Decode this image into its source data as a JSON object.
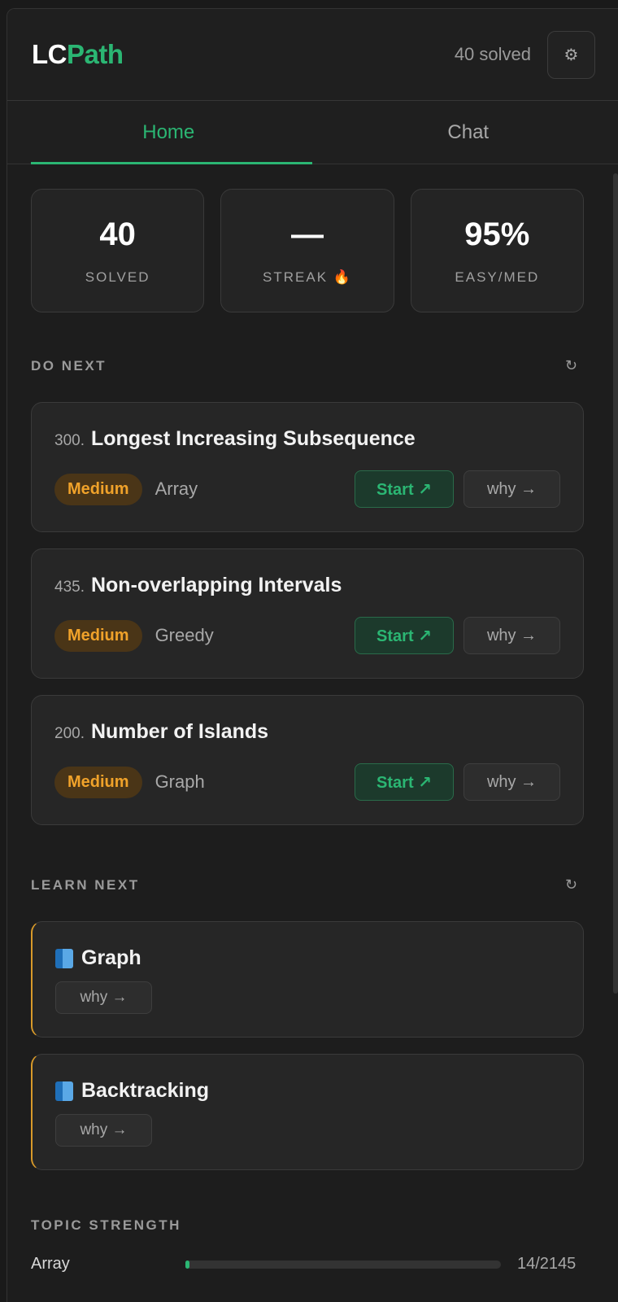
{
  "header": {
    "logo_lc": "LC",
    "logo_path": "Path",
    "solved_text": "40 solved",
    "settings_icon": "gear-icon"
  },
  "tabs": [
    {
      "label": "Home",
      "active": true
    },
    {
      "label": "Chat",
      "active": false
    }
  ],
  "stats": [
    {
      "value": "40",
      "label": "SOLVED"
    },
    {
      "value": "—",
      "label": "STREAK 🔥"
    },
    {
      "value": "95%",
      "label": "EASY/MED"
    }
  ],
  "do_next": {
    "title": "DO NEXT",
    "refresh_icon": "refresh-icon",
    "items": [
      {
        "num": "300.",
        "name": "Longest Increasing Subsequence",
        "difficulty": "Medium",
        "topic": "Array",
        "start": "Start ↗",
        "why": "why →"
      },
      {
        "num": "435.",
        "name": "Non-overlapping Intervals",
        "difficulty": "Medium",
        "topic": "Greedy",
        "start": "Start ↗",
        "why": "why →"
      },
      {
        "num": "200.",
        "name": "Number of Islands",
        "difficulty": "Medium",
        "topic": "Graph",
        "start": "Start ↗",
        "why": "why →"
      }
    ]
  },
  "learn_next": {
    "title": "LEARN NEXT",
    "refresh_icon": "refresh-icon",
    "items": [
      {
        "name": "Graph",
        "why": "why →"
      },
      {
        "name": "Backtracking",
        "why": "why →"
      }
    ]
  },
  "topic_strength": {
    "title": "TOPIC STRENGTH",
    "rows": [
      {
        "name": "Array",
        "count": "14/2145",
        "fraction": 0.0065
      }
    ]
  },
  "colors": {
    "accent": "#2bb673",
    "medium": "#f0a22a",
    "learn_border": "#d89a2a",
    "background": "#1d1d1d"
  }
}
